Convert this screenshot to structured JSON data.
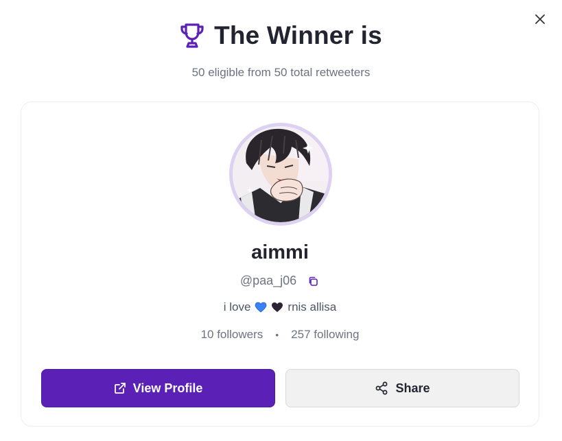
{
  "dialog": {
    "title": "The Winner is",
    "subtitle": "50 eligible from 50 total retweeters"
  },
  "winner": {
    "name": "aimmi",
    "handle": "@paa_j06",
    "bio_prefix": "i love",
    "bio_suffix": "rnis allisa",
    "followers": "10 followers",
    "following": "257 following",
    "stats_separator": "•"
  },
  "actions": {
    "view_profile_label": "View Profile",
    "share_label": "Share"
  },
  "icons": {
    "close": "close-icon",
    "trophy": "trophy-icon",
    "copy": "copy-icon",
    "external_link": "external-link-icon",
    "share": "share-icon",
    "blue_heart": "blue-heart-emoji",
    "black_heart": "black-heart-emoji"
  },
  "colors": {
    "accent": "#5b21b6",
    "trophy": "#5b21b6",
    "avatar_ring": "#ddd1f2",
    "blue_heart": "#3b82f6",
    "black_heart": "#2d2433"
  }
}
